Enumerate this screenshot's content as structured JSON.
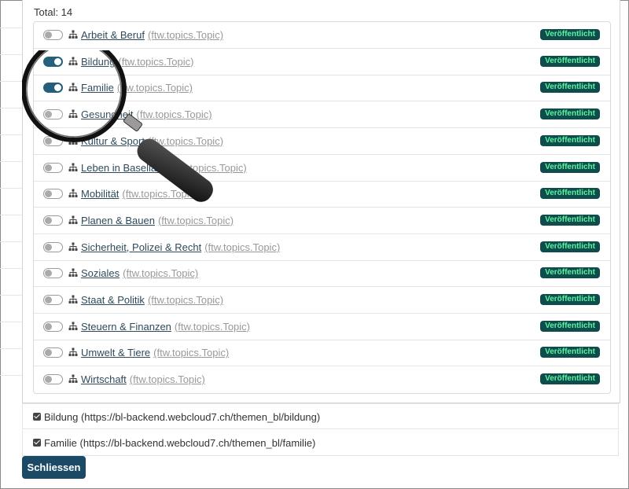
{
  "list": {
    "total_label": "Total: 14",
    "items": [
      {
        "title": "Arbeit & Beruf",
        "type": "(ftw.topics.Topic)",
        "status": "Veröffentlicht",
        "checked": false
      },
      {
        "title": "Bildung",
        "type": "(ftw.topics.Topic)",
        "status": "Veröffentlicht",
        "checked": true
      },
      {
        "title": "Familie",
        "type": "(ftw.topics.Topic)",
        "status": "Veröffentlicht",
        "checked": true
      },
      {
        "title": "Gesundheit",
        "type": "(ftw.topics.Topic)",
        "status": "Veröffentlicht",
        "checked": false
      },
      {
        "title": "Kultur & Sport",
        "type": "(ftw.topics.Topic)",
        "status": "Veröffentlicht",
        "checked": false
      },
      {
        "title": "Leben in Baselland",
        "type": "(ftw.topics.Topic)",
        "status": "Veröffentlicht",
        "checked": false
      },
      {
        "title": "Mobilität",
        "type": "(ftw.topics.Topic)",
        "status": "Veröffentlicht",
        "checked": false
      },
      {
        "title": "Planen & Bauen",
        "type": "(ftw.topics.Topic)",
        "status": "Veröffentlicht",
        "checked": false
      },
      {
        "title": "Sicherheit, Polizei & Recht",
        "type": "(ftw.topics.Topic)",
        "status": "Veröffentlicht",
        "checked": false
      },
      {
        "title": "Soziales",
        "type": "(ftw.topics.Topic)",
        "status": "Veröffentlicht",
        "checked": false
      },
      {
        "title": "Staat & Politik",
        "type": "(ftw.topics.Topic)",
        "status": "Veröffentlicht",
        "checked": false
      },
      {
        "title": "Steuern & Finanzen",
        "type": "(ftw.topics.Topic)",
        "status": "Veröffentlicht",
        "checked": false
      },
      {
        "title": "Umwelt & Tiere",
        "type": "(ftw.topics.Topic)",
        "status": "Veröffentlicht",
        "checked": false
      },
      {
        "title": "Wirtschaft",
        "type": "(ftw.topics.Topic)",
        "status": "Veröffentlicht",
        "checked": false
      }
    ]
  },
  "selected": [
    {
      "label": "Bildung (https://bl-backend.webcloud7.ch/themen_bl/bildung)",
      "checked": true
    },
    {
      "label": "Familie (https://bl-backend.webcloud7.ch/themen_bl/familie)",
      "checked": true
    }
  ],
  "close_button": "Schliessen",
  "colors": {
    "toggle_on": "#1e5a78",
    "badge_bg": "#0f4c4c",
    "badge_text": "#5df5a0",
    "button_bg": "#1b4a66"
  }
}
